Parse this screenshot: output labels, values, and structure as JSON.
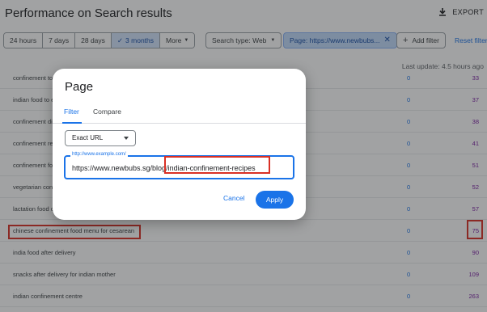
{
  "header": {
    "title": "Performance on Search results",
    "export_label": "EXPORT",
    "export_icon": "download-icon"
  },
  "filters": {
    "ranges": [
      "24 hours",
      "7 days",
      "28 days",
      "3 months",
      "More"
    ],
    "active_range": "3 months",
    "search_type": "Search type: Web",
    "page_filter": "Page: https://www.newbubs...",
    "add_filter": "Add filter",
    "reset": "Reset filters"
  },
  "last_update": "Last update: 4.5 hours ago",
  "rows": [
    {
      "query": "confinement to",
      "clicks": "0",
      "impressions": "33"
    },
    {
      "query": "indian food to e",
      "clicks": "0",
      "impressions": "37"
    },
    {
      "query": "confinement di",
      "clicks": "0",
      "impressions": "38"
    },
    {
      "query": "confinement re",
      "clicks": "0",
      "impressions": "41"
    },
    {
      "query": "confinement fo",
      "clicks": "0",
      "impressions": "51"
    },
    {
      "query": "vegetarian conf",
      "clicks": "0",
      "impressions": "52"
    },
    {
      "query": "lactation food c",
      "clicks": "0",
      "impressions": "57"
    },
    {
      "query": "chinese confinement food menu for cesarean",
      "clicks": "0",
      "impressions": "75"
    },
    {
      "query": "india food after delivery",
      "clicks": "0",
      "impressions": "90"
    },
    {
      "query": "snacks after delivery for indian mother",
      "clicks": "0",
      "impressions": "109"
    },
    {
      "query": "indian confinement centre",
      "clicks": "0",
      "impressions": "263"
    }
  ],
  "dialog": {
    "title": "Page",
    "tabs": [
      "Filter",
      "Compare"
    ],
    "match_type": "Exact URL",
    "url_placeholder": "http://www.example.com/",
    "url_value": "https://www.newbubs.sg/blog/indian-confinement-recipes",
    "cancel": "Cancel",
    "apply": "Apply"
  },
  "colors": {
    "accent": "#1a73e8",
    "highlight": "#d93025",
    "impressions": "#7b1fa2"
  }
}
